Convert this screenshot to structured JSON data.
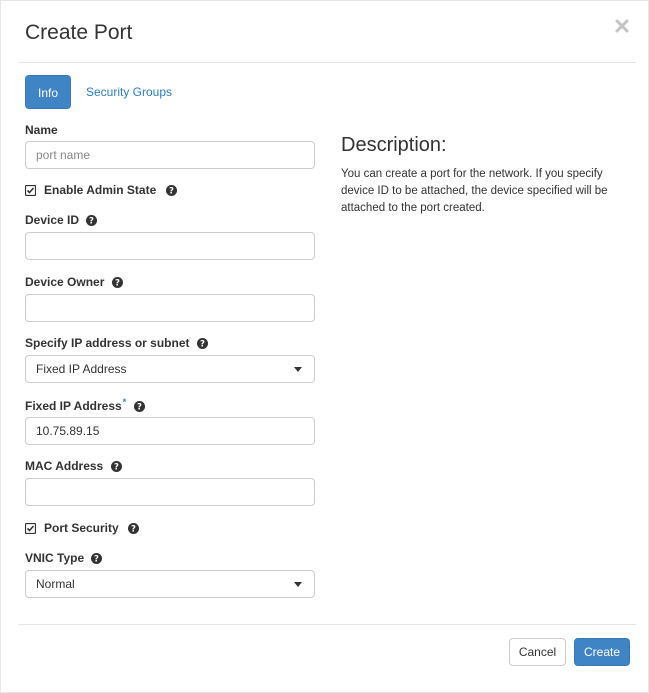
{
  "dialog": {
    "title": "Create Port",
    "close_icon": "close-icon"
  },
  "tabs": [
    {
      "label": "Info",
      "active": true
    },
    {
      "label": "Security Groups",
      "active": false
    }
  ],
  "form": {
    "name": {
      "label": "Name",
      "placeholder": "port name",
      "value": ""
    },
    "enable_admin_state": {
      "label": "Enable Admin State",
      "checked": true
    },
    "device_id": {
      "label": "Device ID",
      "value": ""
    },
    "device_owner": {
      "label": "Device Owner",
      "value": ""
    },
    "specify_ip": {
      "label": "Specify IP address or subnet",
      "selected": "Fixed IP Address"
    },
    "fixed_ip": {
      "label": "Fixed IP Address",
      "required_mark": "*",
      "value": "10.75.89.15"
    },
    "mac_address": {
      "label": "MAC Address",
      "value": ""
    },
    "port_security": {
      "label": "Port Security",
      "checked": true
    },
    "vnic_type": {
      "label": "VNIC Type",
      "selected": "Normal"
    }
  },
  "description": {
    "title": "Description:",
    "text": "You can create a port for the network. If you specify device ID to be attached, the device specified will be attached to the port created."
  },
  "footer": {
    "cancel_label": "Cancel",
    "create_label": "Create"
  },
  "colors": {
    "primary": "#3f84c5",
    "link": "#2e7dbf",
    "border": "#cccccc"
  }
}
